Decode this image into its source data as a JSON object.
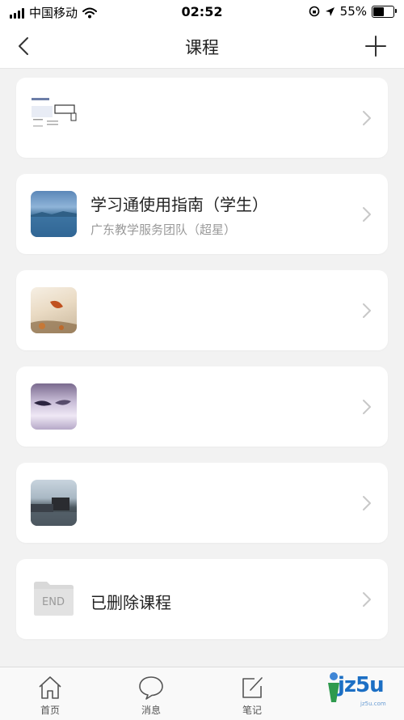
{
  "status_bar": {
    "carrier": "中国移动",
    "time": "02:52",
    "battery_percent": "55%",
    "battery_level": 0.55
  },
  "nav": {
    "title": "课程",
    "back_icon": "chevron-left-icon",
    "add_icon": "plus-icon"
  },
  "courses": [
    {
      "title": "",
      "subtitle": "",
      "thumb": "document-thumbnail"
    },
    {
      "title": "学习通使用指南（学生）",
      "subtitle": "广东教学服务团队（超星）",
      "thumb": "lake-thumbnail"
    },
    {
      "title": "",
      "subtitle": "",
      "thumb": "leaf-thumbnail"
    },
    {
      "title": "",
      "subtitle": "",
      "thumb": "purple-thumbnail"
    },
    {
      "title": "",
      "subtitle": "",
      "thumb": "building-thumbnail"
    }
  ],
  "deleted": {
    "folder_label": "END",
    "title": "已删除课程"
  },
  "tabs": [
    {
      "label": "首页",
      "icon": "home-icon"
    },
    {
      "label": "消息",
      "icon": "message-icon"
    },
    {
      "label": "笔记",
      "icon": "note-icon"
    }
  ],
  "watermark": {
    "text": "jz5u",
    "sub": "jz5u.com"
  }
}
